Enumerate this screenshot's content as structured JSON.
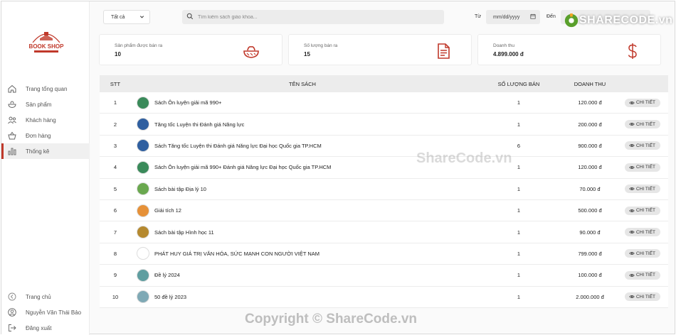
{
  "sidebar": {
    "logo_text": "BOOK SHOP",
    "items": [
      {
        "label": "Trang tổng quan",
        "icon": "home-icon"
      },
      {
        "label": "Sản phẩm",
        "icon": "product-bowl-icon"
      },
      {
        "label": "Khách hàng",
        "icon": "users-icon"
      },
      {
        "label": "Đơn hàng",
        "icon": "basket-icon"
      },
      {
        "label": "Thống kê",
        "icon": "bar-chart-icon",
        "active": true
      }
    ],
    "bottom": [
      {
        "label": "Trang chủ",
        "icon": "chevron-left-circle-icon"
      },
      {
        "label": "Nguyễn Văn Thái Bảo",
        "icon": "user-circle-icon"
      },
      {
        "label": "Đăng xuất",
        "icon": "logout-icon"
      }
    ]
  },
  "topbar": {
    "filter_value": "Tất cả",
    "search_placeholder": "Tìm kiếm sách giáo khoa...",
    "from_label": "Từ",
    "date_placeholder": "mm/dd/yyyy",
    "to_label": "Đến"
  },
  "stats": [
    {
      "title": "Sản phẩm được bán ra",
      "value": "10",
      "icon": "bowl-icon"
    },
    {
      "title": "Số lượng bán ra",
      "value": "15",
      "icon": "document-icon"
    },
    {
      "title": "Doanh thu",
      "value": "4.899.000 đ",
      "icon": "dollar-icon"
    }
  ],
  "table": {
    "headers": {
      "stt": "STT",
      "name": "TÊN SÁCH",
      "qty": "SỐ LƯỢNG BÁN",
      "revenue": "DOANH THU",
      "action": ""
    },
    "action_label": "CHI TIẾT",
    "rows": [
      {
        "stt": "1",
        "name": "Sách Ôn luyện giải mã 990+",
        "qty": "1",
        "revenue": "120.000 đ",
        "thumb": "#3a8a5a"
      },
      {
        "stt": "2",
        "name": "Tăng tốc Luyện thi Đánh giá Năng lực",
        "qty": "1",
        "revenue": "200.000 đ",
        "thumb": "#2f5fa0"
      },
      {
        "stt": "3",
        "name": "Sách Tăng tốc Luyện thi Đánh giá Năng lực Đại học Quốc gia TP.HCM",
        "qty": "6",
        "revenue": "900.000 đ",
        "thumb": "#2f5fa0"
      },
      {
        "stt": "4",
        "name": "Sách Ôn luyện giải mã 990+ Đánh giá Năng lực Đại học Quốc gia TP.HCM",
        "qty": "1",
        "revenue": "120.000 đ",
        "thumb": "#3a8a5a"
      },
      {
        "stt": "5",
        "name": "Sách bài tập Địa lý 10",
        "qty": "1",
        "revenue": "70.000 đ",
        "thumb": "#6aa84f"
      },
      {
        "stt": "6",
        "name": "Giải tích 12",
        "qty": "1",
        "revenue": "500.000 đ",
        "thumb": "#e69138"
      },
      {
        "stt": "7",
        "name": "Sách bài tập Hình học 11",
        "qty": "1",
        "revenue": "90.000 đ",
        "thumb": "#b5892f"
      },
      {
        "stt": "8",
        "name": "PHÁT HUY GIÁ TRỊ VĂN HÓA, SỨC MẠNH CON NGƯỜI VIỆT NAM",
        "qty": "1",
        "revenue": "799.000 đ",
        "thumb": "#ffffff"
      },
      {
        "stt": "9",
        "name": "Đề lý 2024",
        "qty": "1",
        "revenue": "100.000 đ",
        "thumb": "#5f9ea0"
      },
      {
        "stt": "10",
        "name": "50 đề lý 2023",
        "qty": "1",
        "revenue": "2.000.000 đ",
        "thumb": "#7fa9b5"
      }
    ]
  },
  "watermarks": {
    "center": "ShareCode.vn",
    "footer": "Copyright © ShareCode.vn",
    "brand": "SHARECODE.vn"
  },
  "colors": {
    "accent": "#c0392b",
    "header_bg": "#ececec"
  }
}
